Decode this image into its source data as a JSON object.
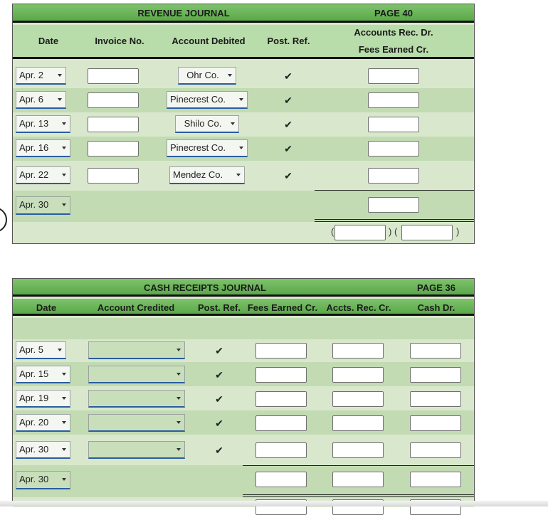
{
  "revenue_journal": {
    "title": "REVENUE JOURNAL",
    "page": "PAGE 40",
    "headers": {
      "date": "Date",
      "invoice": "Invoice No.",
      "account": "Account Debited",
      "post_ref": "Post. Ref.",
      "amount_line1": "Accounts Rec. Dr.",
      "amount_line2": "Fees Earned Cr."
    },
    "rows": [
      {
        "date": "Apr. 2",
        "account": "Ohr Co.",
        "post_ref": "✔"
      },
      {
        "date": "Apr. 6",
        "account": "Pinecrest Co.",
        "post_ref": "✔"
      },
      {
        "date": "Apr. 13",
        "account": "Shilo Co.",
        "post_ref": "✔"
      },
      {
        "date": "Apr. 16",
        "account": "Pinecrest Co.",
        "post_ref": "✔"
      },
      {
        "date": "Apr. 22",
        "account": "Mendez Co.",
        "post_ref": "✔"
      }
    ],
    "total_row": {
      "date": "Apr. 30"
    },
    "paren_open": "(",
    "paren_mid": ") (",
    "paren_close": ")"
  },
  "cash_receipts_journal": {
    "title": "CASH RECEIPTS JOURNAL",
    "page": "PAGE 36",
    "headers": {
      "date": "Date",
      "account": "Account Credited",
      "post_ref": "Post. Ref.",
      "fees": "Fees Earned Cr.",
      "accts": "Accts. Rec. Cr.",
      "cash": "Cash Dr."
    },
    "rows": [
      {
        "date": "Apr. 5",
        "post_ref": "✔"
      },
      {
        "date": "Apr. 15",
        "post_ref": "✔"
      },
      {
        "date": "Apr. 19",
        "post_ref": "✔"
      },
      {
        "date": "Apr. 20",
        "post_ref": "✔"
      },
      {
        "date": "Apr. 30",
        "post_ref": "✔"
      }
    ],
    "total_row": {
      "date": "Apr. 30"
    }
  },
  "colors": {
    "header_green": "#6cb85a",
    "row_light": "#d9e8cd",
    "row_dark": "#c2dbb3",
    "underline_blue": "#2a5d9f"
  }
}
